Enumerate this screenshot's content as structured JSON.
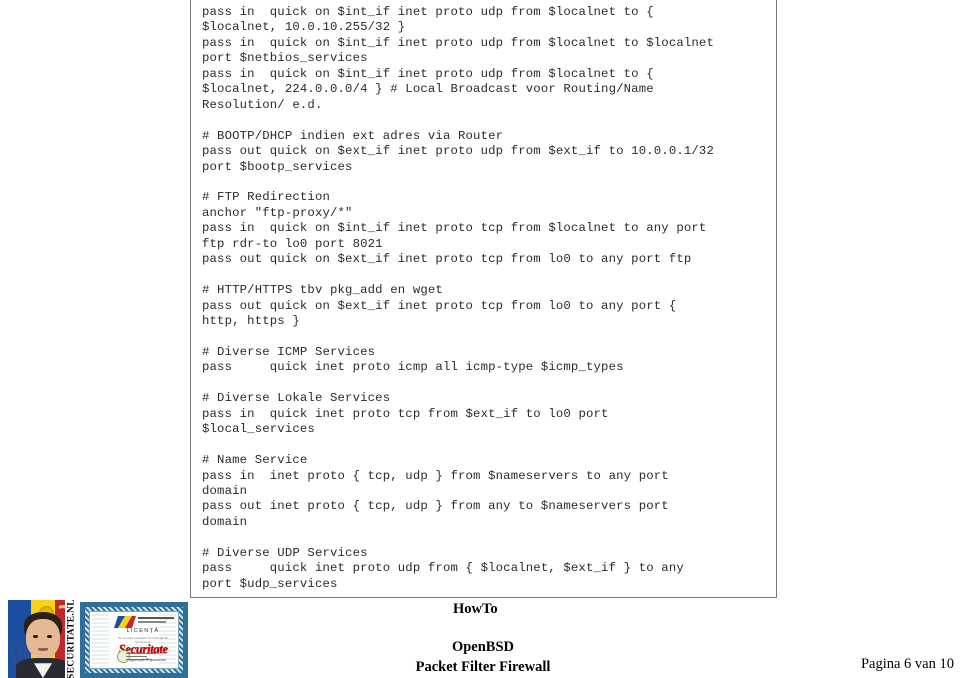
{
  "document": {
    "type": "pdf-page",
    "page_label": "Pagina 6 van 10",
    "footer": {
      "howto_label": "HowTo",
      "title_line1": "OpenBSD",
      "title_line2": "Packet Filter Firewall"
    },
    "images": {
      "portrait": {
        "alt": "Portrait on Romanian flag background",
        "vertical_label": "SECURITATE.NL"
      },
      "certificate": {
        "alt": "Securitate licence certificate",
        "licenta_label": "LICENȚĂ",
        "sub_label": "Se acordă prezenta licență de IT Securitate",
        "title": "Securitate",
        "motto": "Prea siguranță IT garantată"
      }
    }
  },
  "code_block": {
    "language": "pf.conf",
    "border_color": "#7a7a7a",
    "text_color": "#2b2b2b",
    "background": "#ffffff",
    "lines": [
      "pass in  quick on $int_if inet proto udp from $localnet to {",
      "$localnet, 10.0.10.255/32 }",
      "pass in  quick on $int_if inet proto udp from $localnet to $localnet",
      "port $netbios_services",
      "pass in  quick on $int_if inet proto udp from $localnet to {",
      "$localnet, 224.0.0.0/4 } # Local Broadcast voor Routing/Name",
      "Resolution/ e.d.",
      "",
      "# BOOTP/DHCP indien ext adres via Router",
      "pass out quick on $ext_if inet proto udp from $ext_if to 10.0.0.1/32",
      "port $bootp_services",
      "",
      "# FTP Redirection",
      "anchor \"ftp-proxy/*\"",
      "pass in  quick on $int_if inet proto tcp from $localnet to any port",
      "ftp rdr-to lo0 port 8021",
      "pass out quick on $ext_if inet proto tcp from lo0 to any port ftp",
      "",
      "# HTTP/HTTPS tbv pkg_add en wget",
      "pass out quick on $ext_if inet proto tcp from lo0 to any port {",
      "http, https }",
      "",
      "# Diverse ICMP Services",
      "pass     quick inet proto icmp all icmp-type $icmp_types",
      "",
      "# Diverse Lokale Services",
      "pass in  quick inet proto tcp from $ext_if to lo0 port",
      "$local_services",
      "",
      "# Name Service",
      "pass in  inet proto { tcp, udp } from $nameservers to any port",
      "domain",
      "pass out inet proto { tcp, udp } from any to $nameservers port",
      "domain",
      "",
      "# Diverse UDP Services",
      "pass     quick inet proto udp from { $localnet, $ext_if } to any",
      "port $udp_services"
    ]
  }
}
